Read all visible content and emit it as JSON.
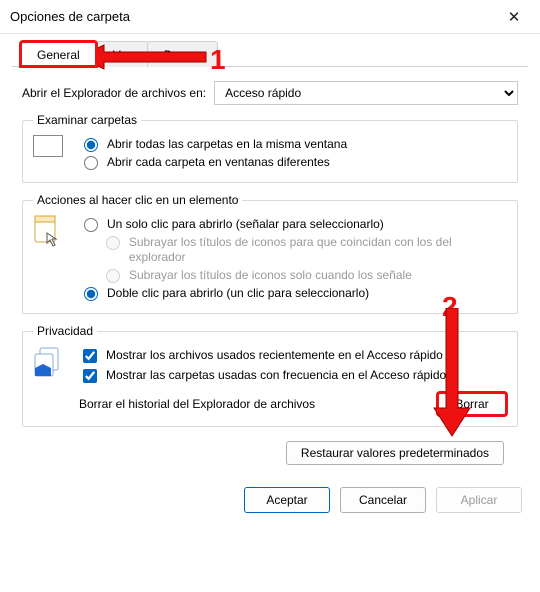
{
  "window": {
    "title": "Opciones de carpeta"
  },
  "tabs": {
    "general": "General",
    "ver": "Ver",
    "buscar": "Buscar"
  },
  "openIn": {
    "label": "Abrir el Explorador de archivos en:",
    "selected": "Acceso rápido"
  },
  "browseFolders": {
    "legend": "Examinar carpetas",
    "sameWindow": "Abrir todas las carpetas en la misma ventana",
    "newWindow": "Abrir cada carpeta en ventanas diferentes"
  },
  "clickItems": {
    "legend": "Acciones al hacer clic en un elemento",
    "single": "Un solo clic para abrirlo (señalar para seleccionarlo)",
    "sub1": "Subrayar los títulos de iconos para que coincidan con los del explorador",
    "sub2": "Subrayar los títulos de iconos solo cuando los señale",
    "double": "Doble clic para abrirlo (un clic para seleccionarlo)"
  },
  "privacy": {
    "legend": "Privacidad",
    "recentFiles": "Mostrar los archivos usados recientemente en el Acceso rápido",
    "frequentFolders": "Mostrar las carpetas usadas con frecuencia en el Acceso rápido",
    "clearLabel": "Borrar el historial del Explorador de archivos",
    "clearButton": "Borrar"
  },
  "restoreDefaults": "Restaurar valores predeterminados",
  "dialogButtons": {
    "ok": "Aceptar",
    "cancel": "Cancelar",
    "apply": "Aplicar"
  },
  "annotations": {
    "n1": "1",
    "n2": "2"
  },
  "colors": {
    "accent": "#0067c0",
    "annotation": "#e11"
  }
}
